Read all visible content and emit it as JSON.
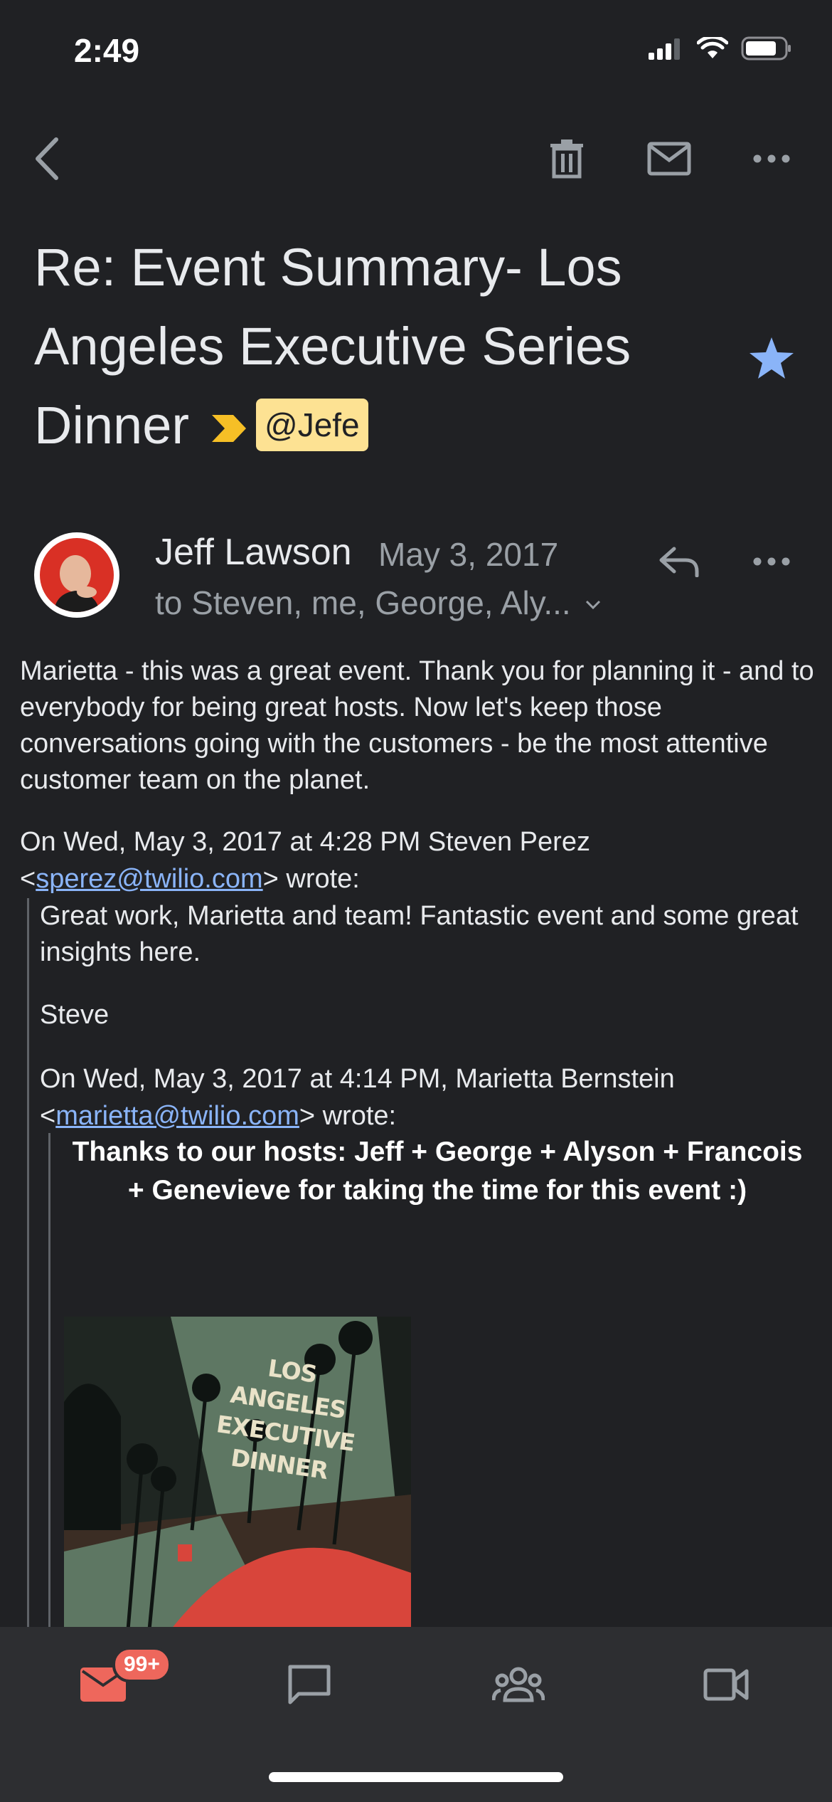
{
  "status": {
    "time": "2:49"
  },
  "toolbar": {
    "icons": [
      "back-icon",
      "delete-icon",
      "mark-unread-icon",
      "more-icon"
    ]
  },
  "email": {
    "subject": "Re: Event Summary- Los Angeles Executive Series Dinner",
    "label": "@Jefe",
    "starred": true,
    "sender": "Jeff Lawson",
    "date": "May 3, 2017",
    "recipients": "to Steven, me, George, Aly...",
    "body": "Marietta - this was a great event. Thank you for planning it - and to everybody for being great hosts. Now let's keep those conversations going with the customers - be the most attentive customer team on the planet.",
    "quote1": {
      "attr_prefix": "On Wed, May 3, 2017 at 4:28 PM Steven Perez <",
      "email": "sperez@twilio.com",
      "attr_suffix": "> wrote:",
      "body": "Great work, Marietta and team! Fantastic event and some great insights here.",
      "signature": "Steve"
    },
    "quote2": {
      "attr_prefix": "On Wed, May 3, 2017 at 4:14 PM, Marietta Bernstein <",
      "email": "marietta@twilio.com",
      "attr_suffix": "> wrote:",
      "body": "Thanks to our hosts: Jeff + George + Alyson + Francois + Genevieve  for taking the time for this event :)"
    },
    "photo_text": [
      "LOS ANGELES",
      "EXECUTIVE",
      "DINNER"
    ]
  },
  "nav": {
    "mail_badge": "99+",
    "items": [
      "mail-icon",
      "chat-icon",
      "spaces-icon",
      "meet-icon"
    ]
  },
  "colors": {
    "background": "#202124",
    "link": "#8ab4f8",
    "label_chip": "#fde293",
    "importance": "#f6bf26",
    "star": "#8ab4f8",
    "badge": "#ee675c",
    "mail_icon": "#ee675c"
  }
}
